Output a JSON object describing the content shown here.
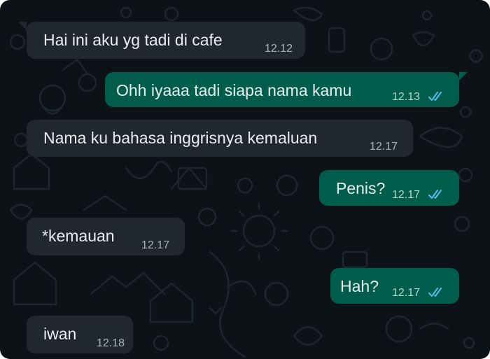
{
  "colors": {
    "background": "#0c1216",
    "incoming_bubble": "#20282d",
    "outgoing_bubble": "#005c4b",
    "read_ticks": "#53bdeb",
    "text": "#e9edef"
  },
  "messages": [
    {
      "direction": "incoming",
      "text": "Hai ini aku yg tadi di cafe",
      "time": "12.12"
    },
    {
      "direction": "outgoing",
      "text": "Ohh iyaaa tadi siapa nama kamu",
      "time": "12.13",
      "status_icon": "double-check-read-icon"
    },
    {
      "direction": "incoming",
      "text": "Nama ku bahasa inggrisnya kemaluan",
      "time": "12.17"
    },
    {
      "direction": "outgoing",
      "text": "Penis?",
      "time": "12.17",
      "status_icon": "double-check-read-icon"
    },
    {
      "direction": "incoming",
      "text": "*kemauan",
      "time": "12.17"
    },
    {
      "direction": "outgoing",
      "text": "Hah?",
      "time": "12.17",
      "status_icon": "double-check-read-icon"
    },
    {
      "direction": "incoming",
      "text": "iwan",
      "time": "12.18"
    }
  ]
}
